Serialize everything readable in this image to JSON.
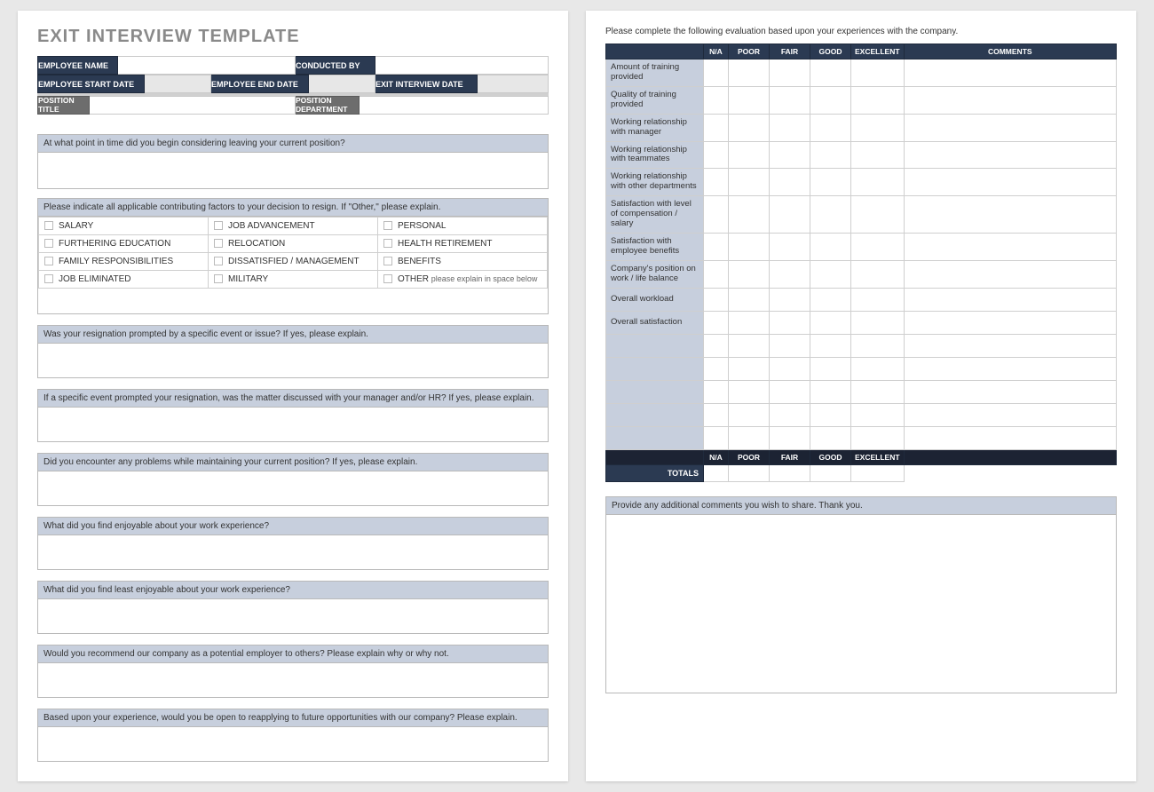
{
  "title": "EXIT INTERVIEW TEMPLATE",
  "header": {
    "employee_name": "EMPLOYEE NAME",
    "conducted_by": "CONDUCTED BY",
    "start_date": "EMPLOYEE START DATE",
    "end_date": "EMPLOYEE END DATE",
    "interview_date": "EXIT INTERVIEW DATE",
    "position_title": "POSITION TITLE",
    "position_department": "POSITION DEPARTMENT"
  },
  "q1": "At what point in time did you begin considering leaving your current position?",
  "q2": "Please indicate all applicable contributing factors to your decision to resign. If \"Other,\" please explain.",
  "factors": {
    "r0c0": "SALARY",
    "r0c1": "JOB ADVANCEMENT",
    "r0c2": "PERSONAL",
    "r1c0": "FURTHERING EDUCATION",
    "r1c1": "RELOCATION",
    "r1c2": "HEALTH RETIREMENT",
    "r2c0": "FAMILY RESPONSIBILITIES",
    "r2c1": "DISSATISFIED / MANAGEMENT",
    "r2c2": "BENEFITS",
    "r3c0": "JOB ELIMINATED",
    "r3c1": "MILITARY",
    "r3c2": "OTHER",
    "other_note": "please explain in space below"
  },
  "q3": "Was your resignation prompted by a specific event or issue? If yes, please explain.",
  "q4": "If a specific event prompted your resignation, was the matter discussed with your manager and/or HR? If yes, please explain.",
  "q5": "Did you encounter any problems while maintaining your current position?  If yes, please explain.",
  "q6": "What did you find enjoyable about your work experience?",
  "q7": "What did you find least enjoyable about your work experience?",
  "q8": "Would you recommend our company as a potential employer to others? Please explain why or why not.",
  "q9": "Based upon your experience, would you be open to reapplying to future opportunities with our company?  Please explain.",
  "page2_instr": "Please complete the following evaluation based upon your experiences with the company.",
  "rating_headers": {
    "na": "N/A",
    "poor": "POOR",
    "fair": "FAIR",
    "good": "GOOD",
    "excellent": "EXCELLENT",
    "comments": "COMMENTS"
  },
  "rating_rows": {
    "0": "Amount of training provided",
    "1": "Quality of training provided",
    "2": "Working relationship with manager",
    "3": "Working relationship with teammates",
    "4": "Working relationship with other departments",
    "5": "Satisfaction with level of compensation / salary",
    "6": "Satisfaction with employee benefits",
    "7": "Company's position on work / life balance",
    "8": "Overall workload",
    "9": "Overall satisfaction"
  },
  "totals_label": "TOTALS",
  "comments_head": "Provide any additional comments you wish to share.  Thank you."
}
